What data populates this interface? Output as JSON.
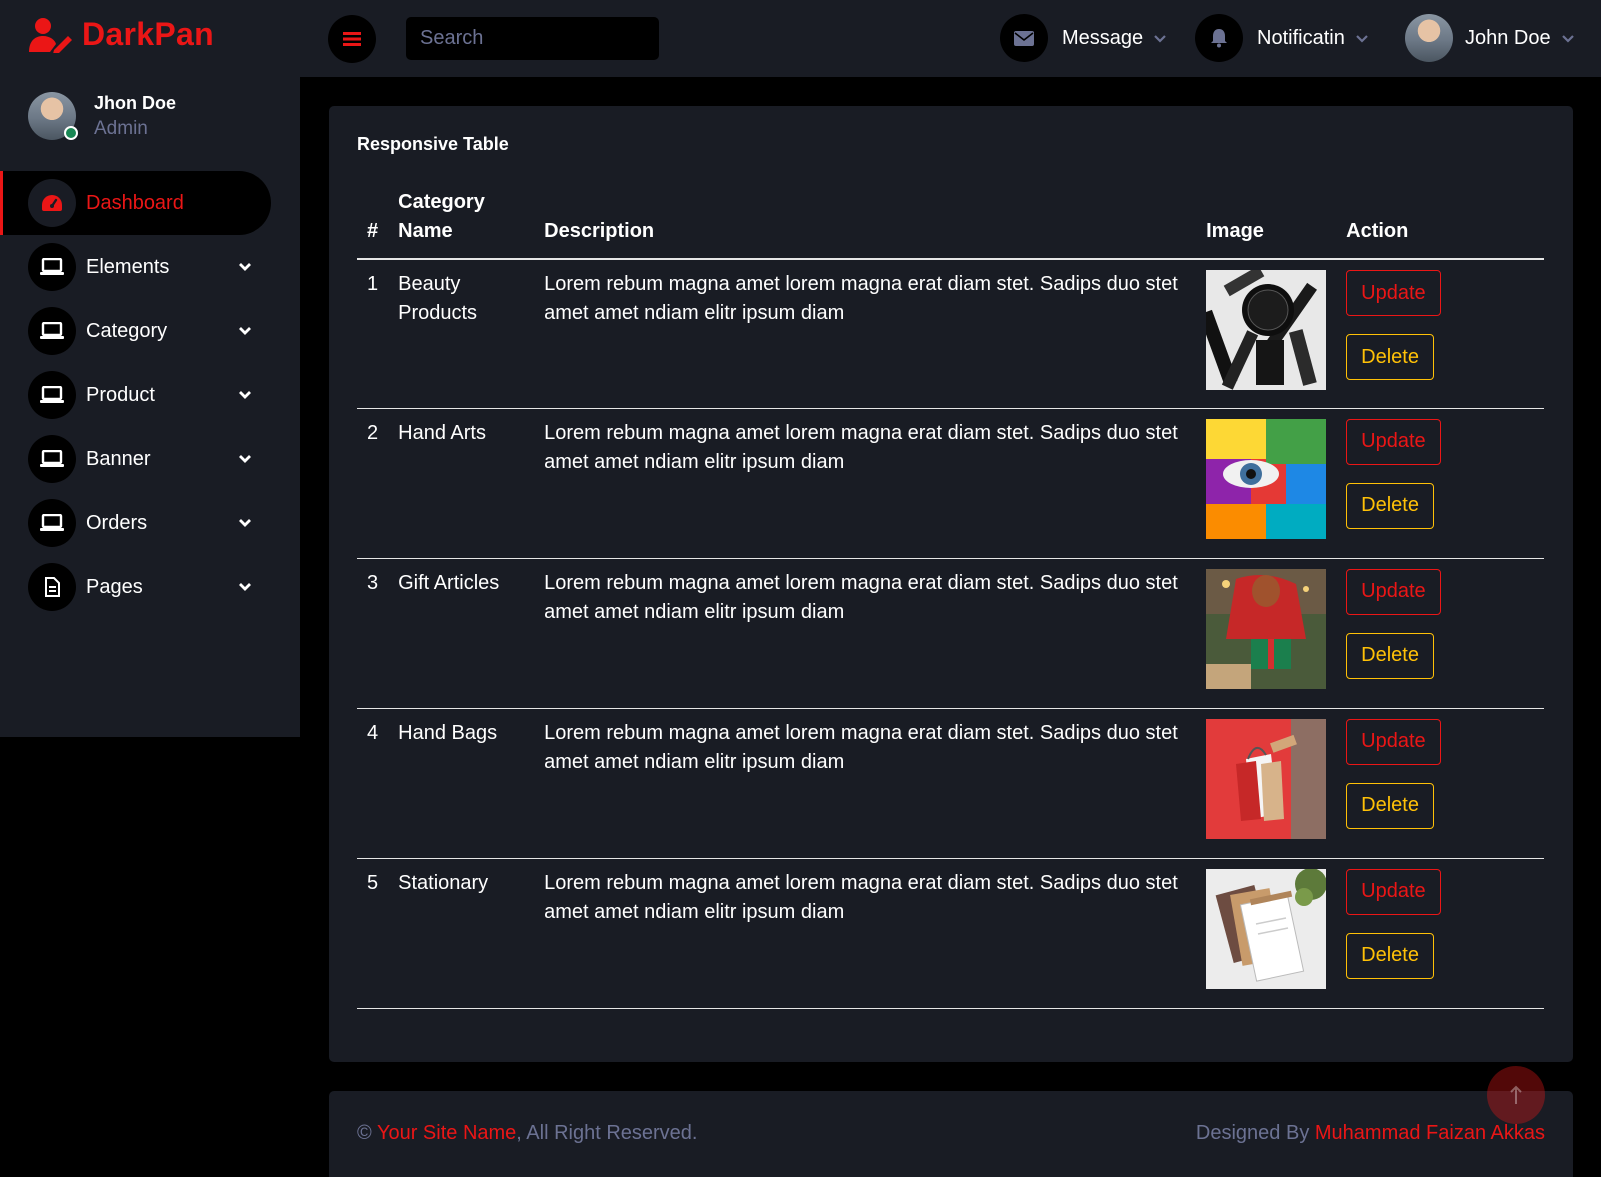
{
  "brand": {
    "name": "DarkPan",
    "icon": "user-edit-icon"
  },
  "sidebar": {
    "user": {
      "name": "Jhon Doe",
      "role": "Admin"
    },
    "items": [
      {
        "label": "Dashboard",
        "icon": "tachometer-icon",
        "active": true
      },
      {
        "label": "Elements",
        "icon": "laptop-icon"
      },
      {
        "label": "Category",
        "icon": "laptop-icon"
      },
      {
        "label": "Product",
        "icon": "laptop-icon"
      },
      {
        "label": "Banner",
        "icon": "laptop-icon"
      },
      {
        "label": "Orders",
        "icon": "laptop-icon"
      },
      {
        "label": "Pages",
        "icon": "file-icon"
      }
    ]
  },
  "topbar": {
    "search_placeholder": "Search",
    "message_label": "Message",
    "notification_label": "Notificatin",
    "user_label": "John Doe"
  },
  "card": {
    "title": "Responsive Table",
    "columns": {
      "num": "#",
      "category_line1": "Category",
      "category_line2": "Name",
      "description": "Description",
      "image": "Image",
      "action": "Action"
    },
    "rows": [
      {
        "num": "1",
        "category": "Beauty Products",
        "description": "Lorem rebum magna amet lorem magna erat diam stet. Sadips duo stet amet amet ndiam elitr ipsum diam",
        "image": "cosmetics-image"
      },
      {
        "num": "2",
        "category": "Hand Arts",
        "description": "Lorem rebum magna amet lorem magna erat diam stet. Sadips duo stet amet amet ndiam elitr ipsum diam",
        "image": "painted-face-image"
      },
      {
        "num": "3",
        "category": "Gift Articles",
        "description": "Lorem rebum magna amet lorem magna erat diam stet. Sadips duo stet amet amet ndiam elitr ipsum diam",
        "image": "gift-wrapping-image"
      },
      {
        "num": "4",
        "category": "Hand Bags",
        "description": "Lorem rebum magna amet lorem magna erat diam stet. Sadips duo stet amet amet ndiam elitr ipsum diam",
        "image": "shopping-bags-image"
      },
      {
        "num": "5",
        "category": "Stationary",
        "description": "Lorem rebum magna amet lorem magna erat diam stet. Sadips duo stet amet amet ndiam elitr ipsum diam",
        "image": "stationery-image"
      }
    ],
    "update_label": "Update",
    "delete_label": "Delete"
  },
  "footer": {
    "copyright_symbol": "©",
    "site_name": "Your Site Name",
    "rights": ", All Right Reserved.",
    "designed_by": "Designed By",
    "designer": "Muhammad Faizan Akkas"
  },
  "colors": {
    "accent": "#eb1616",
    "warning": "#ffc107",
    "panel": "#191c24",
    "muted": "#6c7293"
  }
}
